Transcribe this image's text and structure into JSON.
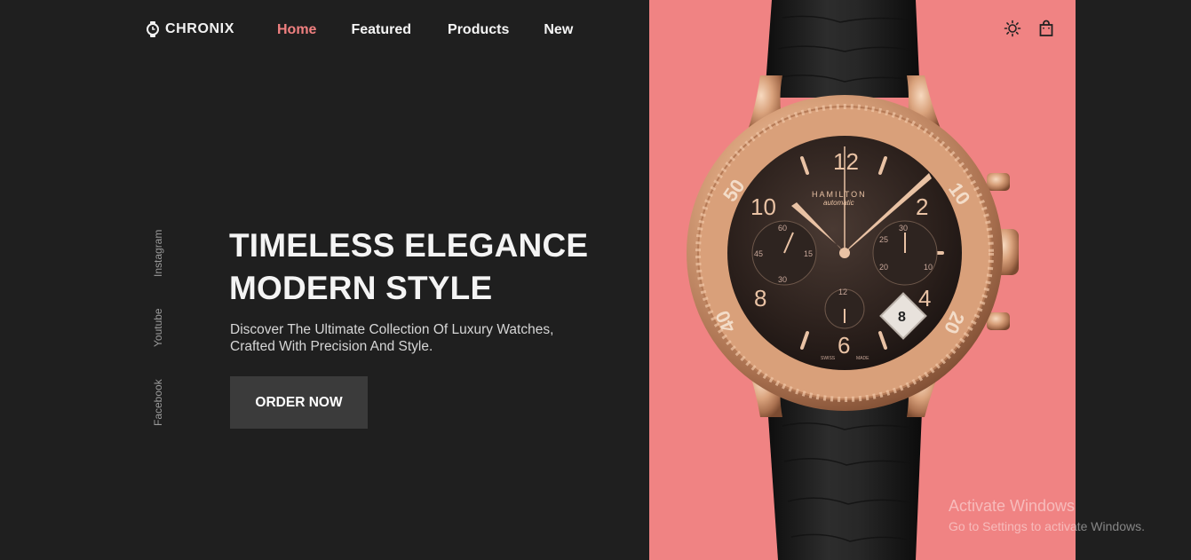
{
  "brand": {
    "name": "CHRONIX",
    "logo_icon": "watch-logo-icon"
  },
  "nav": {
    "items": [
      {
        "label": "Home",
        "active": true
      },
      {
        "label": "Featured",
        "active": false
      },
      {
        "label": "Products",
        "active": false
      },
      {
        "label": "New",
        "active": false
      }
    ]
  },
  "header_icons": [
    {
      "name": "sun-icon"
    },
    {
      "name": "shopping-bag-icon"
    }
  ],
  "socials": [
    "Instagram",
    "Youtube",
    "Facebook"
  ],
  "hero": {
    "title_line1": "TIMELESS ELEGANCE",
    "title_line2": "MODERN STYLE",
    "subtitle_line1": "Discover The Ultimate Collection Of Luxury Watches,",
    "subtitle_line2": "Crafted With Precision And Style.",
    "cta": "ORDER NOW"
  },
  "product_image": {
    "brand_text": "HAMILTON",
    "model_text": "automatic",
    "date": "8",
    "dial_numbers": [
      "12",
      "2",
      "4",
      "6",
      "8",
      "10"
    ],
    "bezel_numbers": [
      "10",
      "20",
      "40",
      "50"
    ],
    "subdial_left": [
      "60",
      "15",
      "30",
      "45"
    ],
    "subdial_right": [
      "30",
      "10",
      "20",
      "25"
    ],
    "subdial_bottom": [
      "12"
    ],
    "bottom_text": [
      "SWISS",
      "MADE"
    ]
  },
  "colors": {
    "background": "#1f1f1f",
    "accent": "#f08080",
    "panel": "#f08383",
    "button": "#3b3b3b"
  },
  "watermark": {
    "line1": "Activate Windows",
    "line2": "Go to Settings to activate Windows."
  }
}
